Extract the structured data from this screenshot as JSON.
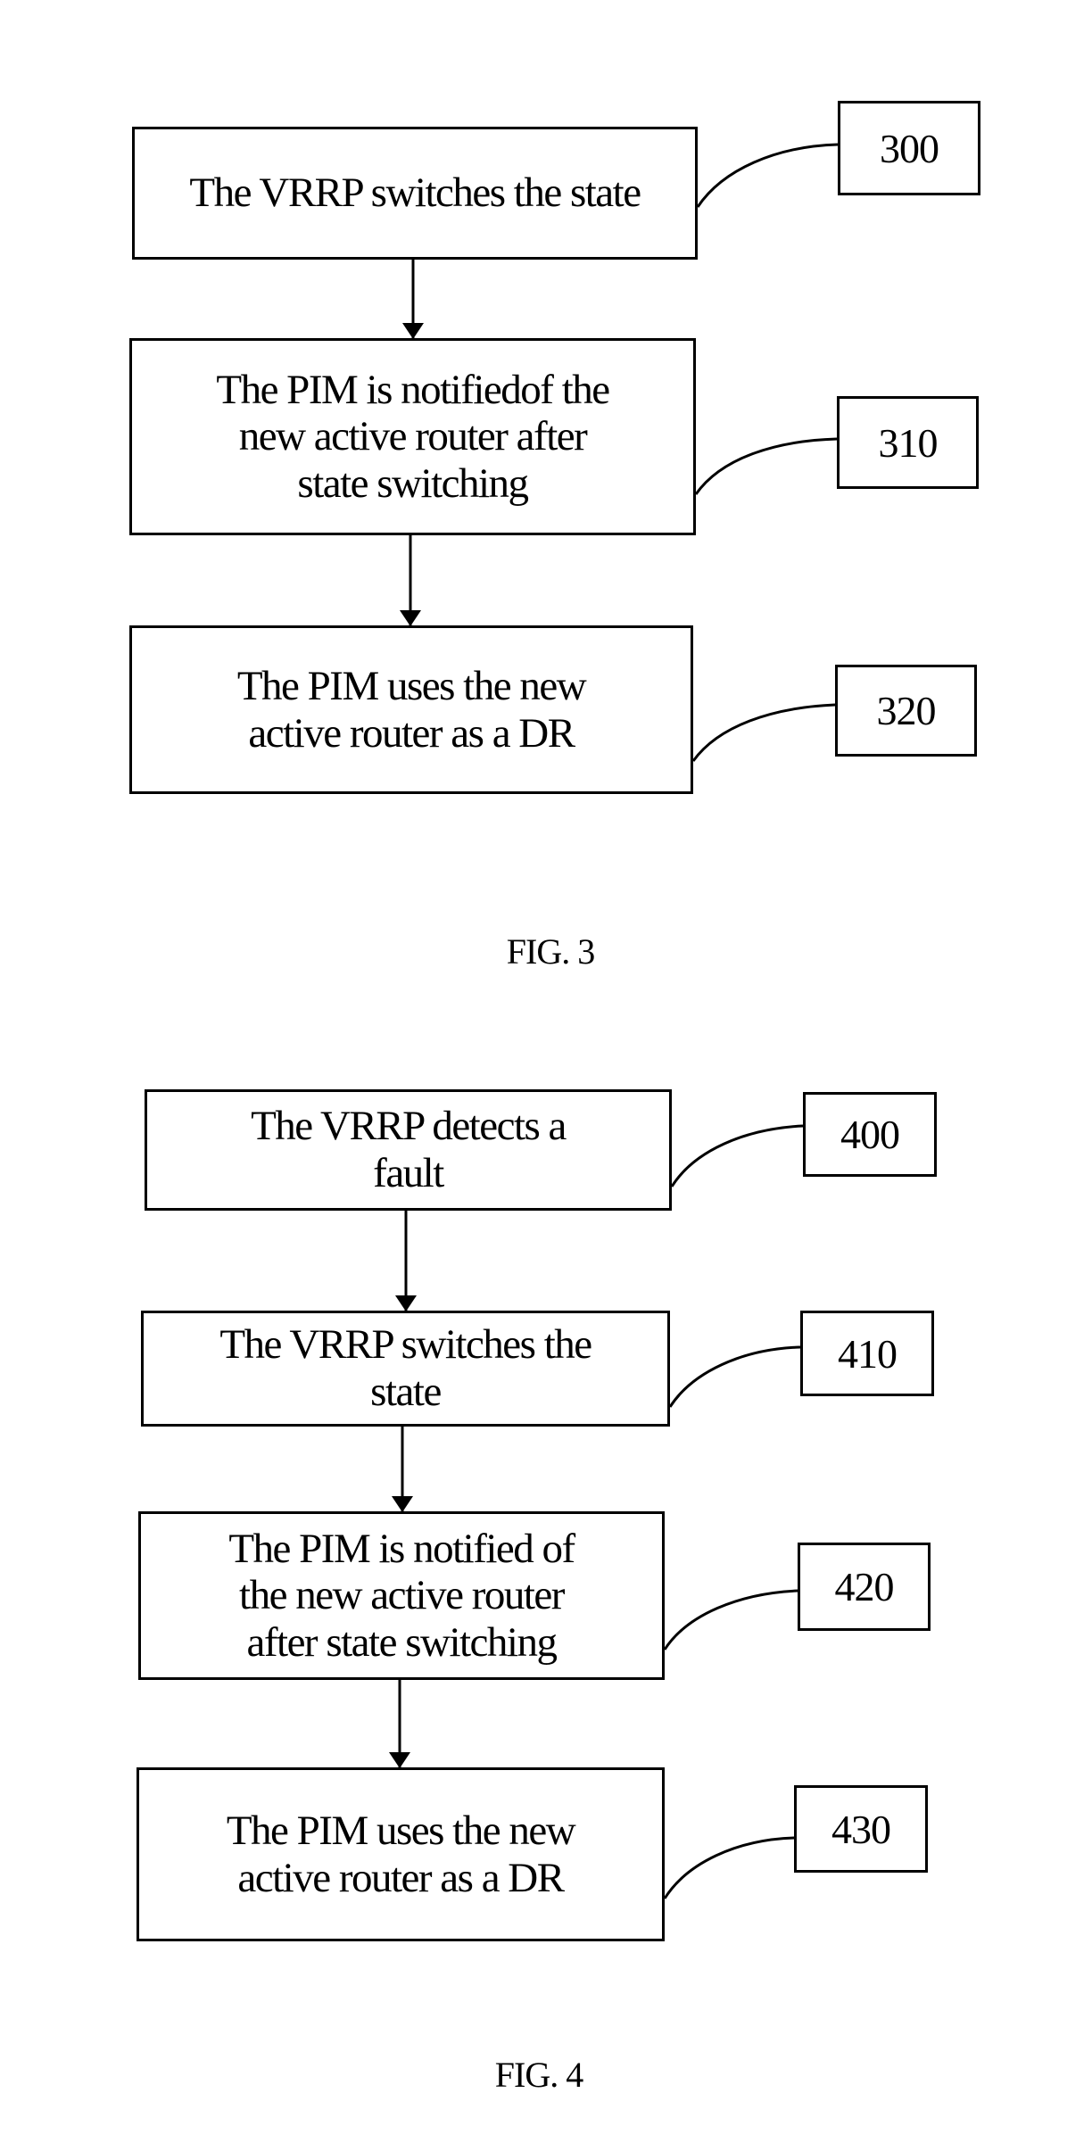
{
  "figures": [
    {
      "caption": "FIG. 3",
      "steps": [
        {
          "text": "The VRRP switches the state",
          "ref": "300"
        },
        {
          "text": "The PIM is notifiedof the\nnew active router after\nstate switching",
          "ref": "310"
        },
        {
          "text": "The PIM uses the new\nactive router as a DR",
          "ref": "320"
        }
      ]
    },
    {
      "caption": "FIG. 4",
      "steps": [
        {
          "text": "The VRRP detects a\nfault",
          "ref": "400"
        },
        {
          "text": "The VRRP switches the\nstate",
          "ref": "410"
        },
        {
          "text": "The PIM is notified of\nthe new  active router\nafter state switching",
          "ref": "420"
        },
        {
          "text": "The PIM uses the new\nactive router as a DR",
          "ref": "430"
        }
      ]
    }
  ]
}
